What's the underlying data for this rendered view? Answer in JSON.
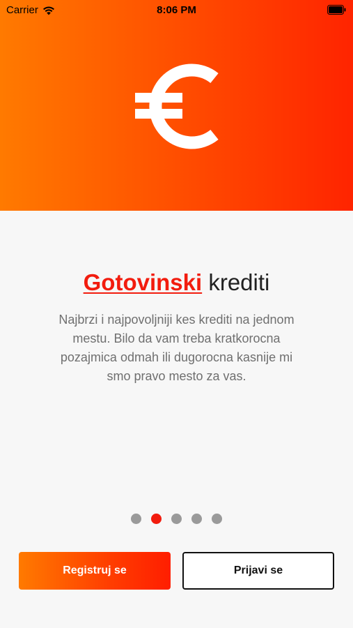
{
  "status_bar": {
    "carrier": "Carrier",
    "time": "8:06 PM",
    "icons": [
      "wifi-icon",
      "battery-icon"
    ]
  },
  "hero": {
    "icon": "euro-icon",
    "gradient_colors": [
      "#ff7a00",
      "#ff2400"
    ]
  },
  "content": {
    "title_accent": "Gotovinski",
    "title_rest": " krediti",
    "description": "Najbrzi i najpovoljniji kes krediti na jednom mestu. Bilo da vam treba kratkorocna pozajmica odmah ili dugorocna kasnije mi smo pravo mesto za vas."
  },
  "pagination": {
    "total": 5,
    "current": 2
  },
  "buttons": {
    "register": "Registruj se",
    "login": "Prijavi se"
  },
  "colors": {
    "accent": "#f21c0e",
    "text": "#222222",
    "muted": "#6f6f6f",
    "dot_inactive": "#9a9a9a"
  }
}
